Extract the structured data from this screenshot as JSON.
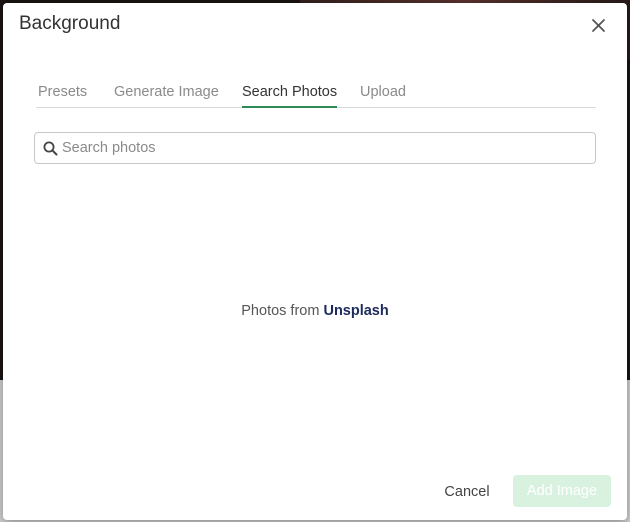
{
  "dialog": {
    "title": "Background"
  },
  "tabs": [
    {
      "label": "Presets",
      "active": false
    },
    {
      "label": "Generate Image",
      "active": false
    },
    {
      "label": "Search Photos",
      "active": true
    },
    {
      "label": "Upload",
      "active": false
    }
  ],
  "search": {
    "placeholder": "Search photos",
    "value": ""
  },
  "credit": {
    "prefix": "Photos from ",
    "link": "Unsplash"
  },
  "footer": {
    "cancel_label": "Cancel",
    "add_label": "Add Image",
    "add_enabled": false
  },
  "colors": {
    "accent": "#2e8b57",
    "link": "#1d2a5c",
    "add_button_disabled": "#d9f2df"
  },
  "icons": {
    "close": "close-icon",
    "search": "search-icon"
  }
}
